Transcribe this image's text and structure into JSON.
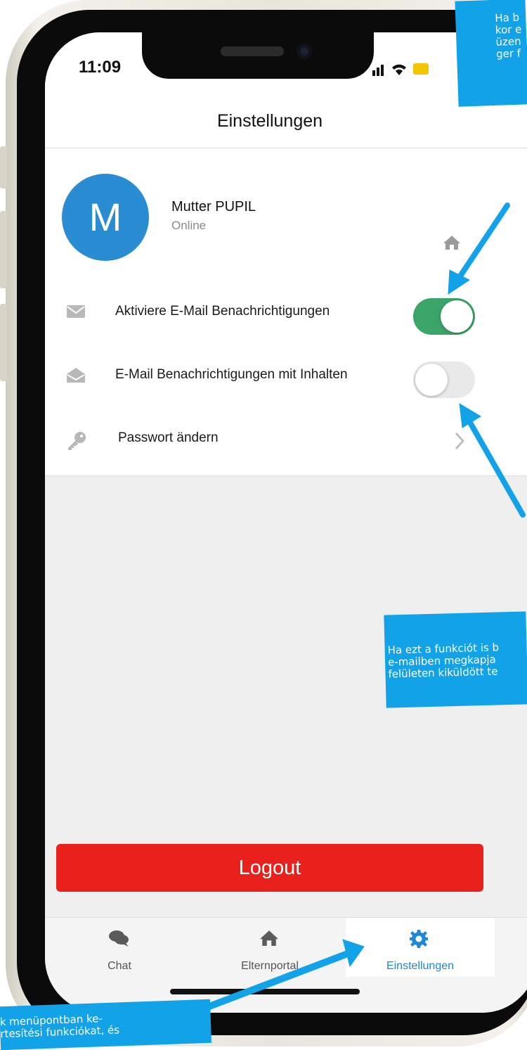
{
  "status_bar": {
    "time": "11:09"
  },
  "header": {
    "title": "Einstellungen"
  },
  "profile": {
    "avatar_letter": "M",
    "name": "Mutter PUPIL",
    "status": "Online"
  },
  "settings": {
    "email_notifications": {
      "label": "Aktiviere E-Mail Benachrichtigungen",
      "enabled": true
    },
    "email_with_content": {
      "label": "E-Mail Benachrichtigungen mit Inhalten",
      "enabled": false
    },
    "change_password": {
      "label": "Passwort ändern"
    }
  },
  "logout": {
    "label": "Logout"
  },
  "tabbar": {
    "tabs": [
      {
        "label": "Chat",
        "icon": "chat-bubbles-icon",
        "active": false
      },
      {
        "label": "Elternportal",
        "icon": "home-icon",
        "active": false
      },
      {
        "label": "Einstellungen",
        "icon": "gear-icon",
        "active": true
      }
    ]
  },
  "colors": {
    "toggle_on": "#3aa469",
    "logout": "#e8211c",
    "avatar": "#2a8dd4",
    "active_tab": "#1e88d6",
    "annotation": "#12a2e8"
  },
  "annotations": {
    "top": "Ha b\nkor e\nüzen\nger f",
    "middle": "Ha ezt a funkciót is b\ne-mailben megkapja\nfelületen kiküldött te",
    "bottom": "k menüpontban ke-\nrtesítési funkciókat, és"
  }
}
